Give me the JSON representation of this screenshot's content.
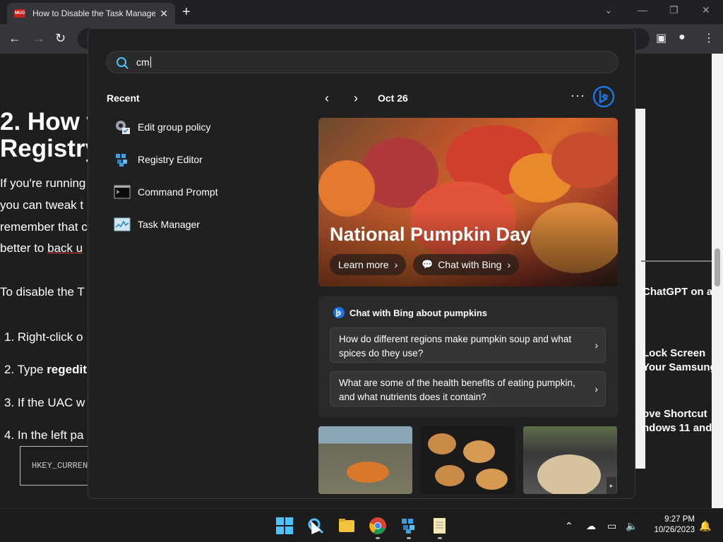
{
  "browser": {
    "tab_title": "How to Disable the Task Manage",
    "favicon_text": "MUO",
    "new_tab": "+",
    "close_tab": "✕"
  },
  "article": {
    "heading_line1": "2. How t",
    "heading_line2": "Registry",
    "para": [
      "If you're running",
      "you can tweak t",
      "remember that c",
      "better to "
    ],
    "para_link": "back u",
    "to_disable": "To disable the T",
    "steps": [
      "1.  Right-click o",
      "2.  Type ",
      "3.  If the UAC w",
      "4.  In the left pa"
    ],
    "step2_bold": "regedit",
    "code": "HKEY_CURREN"
  },
  "sidebar_links": [
    "ChatGPT on a",
    "Lock Screen",
    "Your Samsung",
    "ove Shortcut",
    "ndows 11 and"
  ],
  "search": {
    "query": "cm",
    "recent_title": "Recent",
    "recent": [
      {
        "label": "Edit group policy",
        "icon": "group-policy-icon"
      },
      {
        "label": "Registry Editor",
        "icon": "registry-editor-icon"
      },
      {
        "label": "Command Prompt",
        "icon": "command-prompt-icon"
      },
      {
        "label": "Task Manager",
        "icon": "task-manager-icon"
      }
    ]
  },
  "highlights": {
    "date": "Oct 26",
    "more": "···",
    "hero_title": "National Pumpkin Day",
    "learn_more": "Learn more",
    "chat_with_bing": "Chat with Bing",
    "chat_card_title": "Chat with Bing about pumpkins",
    "prompts": [
      "How do different regions make pumpkin soup and what spices do they use?",
      "What are some of the health benefits of eating pumpkin, and what nutrients does it contain?"
    ]
  },
  "taskbar": {
    "time": "9:27 PM",
    "date": "10/26/2023"
  },
  "colors": {
    "accent": "#4cc2ff",
    "panel_bg": "#202020",
    "bing_blue": "#1b74e4"
  }
}
